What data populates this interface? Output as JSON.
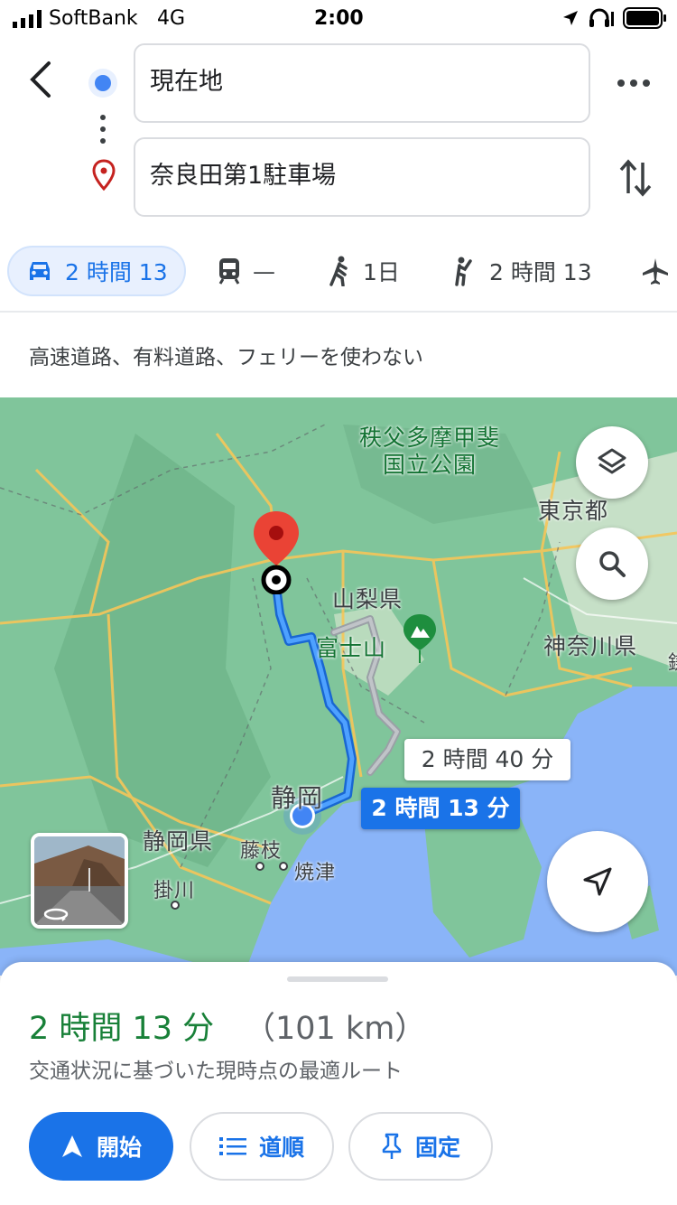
{
  "status_bar": {
    "carrier": "SoftBank",
    "network": "4G",
    "time": "2:00"
  },
  "directions": {
    "origin": "現在地",
    "destination": "奈良田第1駐車場"
  },
  "modes": [
    {
      "icon": "car-icon",
      "label": "2 時間 13",
      "selected": true
    },
    {
      "icon": "train-icon",
      "label": "—"
    },
    {
      "icon": "walk-icon",
      "label": "1日"
    },
    {
      "icon": "ride-hail-icon",
      "label": "2 時間 13"
    },
    {
      "icon": "plane-icon",
      "label": ""
    }
  ],
  "route_options": "高速道路、有料道路、フェリーを使わない",
  "map": {
    "labels": {
      "park": "秩父多摩甲斐\n国立公園",
      "tokyo": "東京都",
      "yamanashi": "山梨県",
      "fuji": "富士山",
      "kanagawa": "神奈川県",
      "shizuoka_city": "静岡",
      "shizuoka_pref": "静岡県",
      "fujieda": "藤枝",
      "yaizu": "焼津",
      "kakegawa": "掛川",
      "kama": "鎌"
    },
    "route_main_label": "2 時間 13 分",
    "route_alt_label": "2 時間 40 分"
  },
  "summary": {
    "duration": "2 時間 13 分",
    "distance": "（101 km）",
    "note": "交通状況に基づいた現時点の最適ルート"
  },
  "actions": {
    "start": "開始",
    "steps": "道順",
    "pin": "固定"
  },
  "colors": {
    "accent": "#1a73e8",
    "duration_green": "#188038",
    "map_green": "#7fc79a",
    "water": "#8ab4f8"
  }
}
